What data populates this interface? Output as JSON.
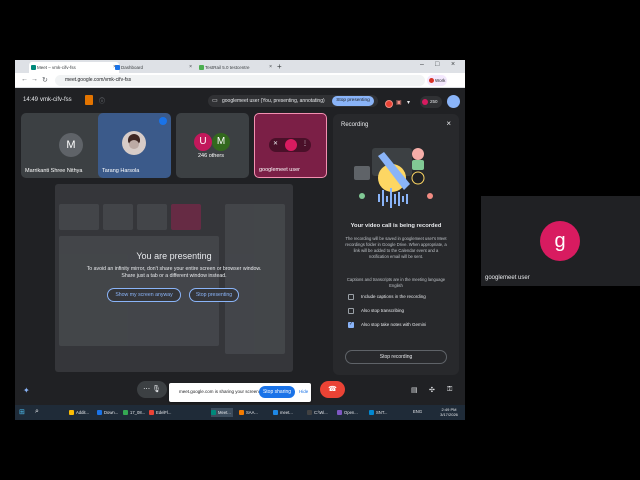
{
  "browser": {
    "tabs": [
      {
        "title": "Meet – vmk-cifv-fss",
        "active": true
      },
      {
        "title": "Dashboard",
        "active": false
      },
      {
        "title": "TestRail 5.0 testcentre",
        "active": false
      }
    ],
    "url": "meet.google.com/vmk-cifv-fss",
    "profile_label": "Work",
    "ask_gemini": "Ask Gemini"
  },
  "meet": {
    "time": "14:49",
    "meeting_code": "vmk-cifv-fss",
    "presenting_chip": "googlemeet user (You, presenting, annotating)",
    "stop_presenting": "Stop presenting",
    "people_count": "250",
    "tiles": [
      {
        "name": "Marrikanti Shree Nithya",
        "initial": "M"
      },
      {
        "name": "Tarang Harsola"
      },
      {
        "name": "246 others",
        "initials": [
          "U",
          "M"
        ]
      },
      {
        "name": "googlemeet user"
      }
    ],
    "preview": {
      "title": "You are presenting",
      "subtitle": "To avoid an infinity mirror, don't share your entire screen or browser window. Share just a tab or a different window instead.",
      "show_button": "Show my screen anyway",
      "stop_button": "Stop presenting"
    }
  },
  "recording_panel": {
    "title": "Recording",
    "heading": "Your video call is being recorded",
    "body": "The recording will be saved in googlemeet user's Meet recordings folder in Google Drive. When appropriate, a link will be added to the Calendar event and a notification email will be sent.",
    "body2": "Captions and transcripts are in the meeting language English",
    "options": [
      {
        "label": "Include captions in the recording",
        "checked": false
      },
      {
        "label": "Also stop transcribing",
        "checked": false
      },
      {
        "label": "Also stop take notes with Gemini",
        "checked": true
      }
    ],
    "stop_button": "Stop recording"
  },
  "share_bar": {
    "text": "meet.google.com is sharing your screen.",
    "stop": "Stop sharing",
    "hide": "Hide"
  },
  "right_tile": {
    "name": "googlemeet user",
    "initial": "g"
  },
  "taskbar": {
    "items": [
      "Addit...",
      "Down...",
      "17_08...",
      "EdelFl...",
      "Meet...",
      "SAA...",
      "meet...",
      "C:\\Wi...",
      "Open...",
      "SNT..."
    ],
    "lang": "ENG",
    "time": "2:49 PM",
    "date": "3/17/2026"
  },
  "colors": {
    "accent": "#8ab4f8",
    "danger": "#ea4335",
    "avatar_pink": "#d81b60"
  }
}
